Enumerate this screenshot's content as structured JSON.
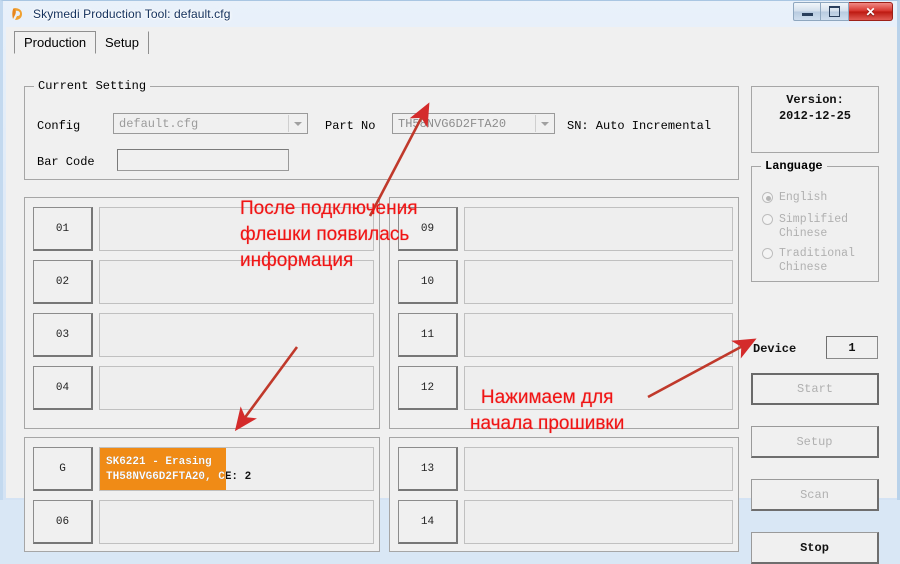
{
  "window": {
    "title": "Skymedi Production Tool: default.cfg",
    "icon": "app-icon",
    "caption_buttons": [
      {
        "name": "minimize",
        "glyph": "—"
      },
      {
        "name": "maximize",
        "glyph": "□"
      },
      {
        "name": "close",
        "glyph": "✕"
      }
    ]
  },
  "tabs": [
    {
      "label": "Production",
      "active": true
    },
    {
      "label": "Setup",
      "active": false
    }
  ],
  "current_setting": {
    "group_label": "Current Setting",
    "config_label": "Config",
    "config_value": "default.cfg",
    "part_no_label": "Part No",
    "part_no_value": "TH58NVG6D2FTA20",
    "sn_label": "SN: Auto Incremental",
    "bar_code_label": "Bar Code",
    "bar_code_value": ""
  },
  "slots_left_a": [
    {
      "id": "01",
      "text": "",
      "progress": 0
    },
    {
      "id": "02",
      "text": "",
      "progress": 0
    },
    {
      "id": "03",
      "text": "",
      "progress": 0
    },
    {
      "id": "04",
      "text": "",
      "progress": 0
    }
  ],
  "slots_right_a": [
    {
      "id": "09",
      "text": "",
      "progress": 0
    },
    {
      "id": "10",
      "text": "",
      "progress": 0
    },
    {
      "id": "11",
      "text": "",
      "progress": 0
    },
    {
      "id": "12",
      "text": "",
      "progress": 0
    }
  ],
  "slots_left_b": [
    {
      "id": "G",
      "line1": "SK6221 - Erasing",
      "line2": "TH58NVG6D2FTA20, CE: 2",
      "progress": 46
    },
    {
      "id": "06",
      "line1": "",
      "line2": "",
      "progress": 0
    }
  ],
  "slots_right_b": [
    {
      "id": "13",
      "line1": "",
      "line2": "",
      "progress": 0
    },
    {
      "id": "14",
      "line1": "",
      "line2": "",
      "progress": 0
    }
  ],
  "sidebar": {
    "version_label": "Version:",
    "version_value": "2012-12-25",
    "language_group": "Language",
    "languages": [
      {
        "label": "English",
        "checked": true
      },
      {
        "label": "Simplified\nChinese",
        "checked": false
      },
      {
        "label": "Traditional\nChinese",
        "checked": false
      }
    ],
    "device_label": "Device",
    "device_value": "1",
    "buttons": [
      {
        "label": "Start",
        "enabled": false
      },
      {
        "label": "Setup",
        "enabled": false
      },
      {
        "label": "Scan",
        "enabled": false
      },
      {
        "label": "Stop",
        "enabled": true
      }
    ]
  },
  "annotations": {
    "color": "#f01414",
    "note_1": "После подключения\nфлешки появилась\nинформация",
    "note_2": "Нажимаем для\nначала прошивки"
  },
  "colors": {
    "accent_orange": "#f08b16",
    "annotation_red": "#f01414",
    "window_bg": "#f0f0f0",
    "title_text": "#13305c"
  }
}
